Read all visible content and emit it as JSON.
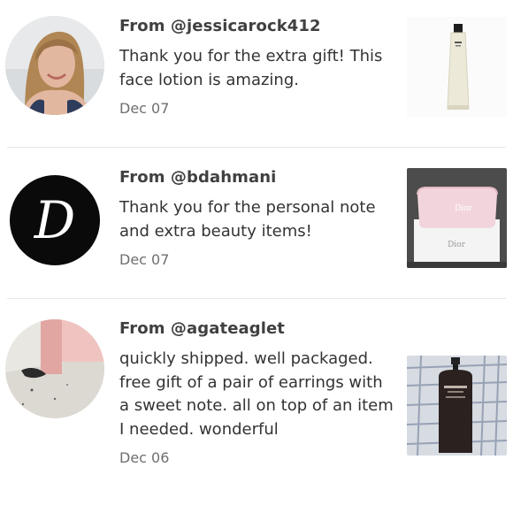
{
  "reviews": [
    {
      "from": "From @jessicarock412",
      "message": "Thank you for the extra gift! This face lotion is amazing.",
      "date": "Dec 07",
      "avatar_icon": "user-photo-avatar",
      "thumb_icon": "lotion-tube-icon"
    },
    {
      "from": "From @bdahmani",
      "message": "Thank you for the personal note and extra beauty items!",
      "date": "Dec 07",
      "avatar_icon": "letter-d-avatar",
      "avatar_letter": "D",
      "thumb_icon": "makeup-bag-icon",
      "thumb_brand": "Dior"
    },
    {
      "from": "From @agateaglet",
      "message": "quickly shipped. well packaged. free gift of a pair of earrings with a sweet note. all on top of an item I needed. wonderful",
      "date": "Dec 06",
      "avatar_icon": "floor-photo-avatar",
      "thumb_icon": "soap-bottle-icon"
    }
  ],
  "colors": {
    "divider": "#e6e6e6",
    "text": "#333333",
    "date": "#6f6f6f"
  }
}
